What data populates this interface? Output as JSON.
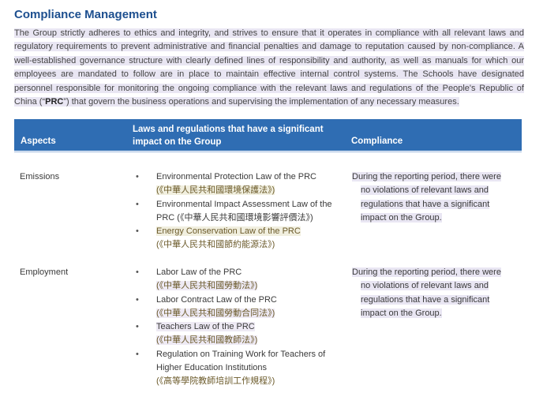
{
  "title": "Compliance Management",
  "intro": {
    "p1": "The Group strictly adheres to ethics and integrity, and strives to ensure that it operates in compliance with all relevant laws and regulatory requirements to prevent administrative and financial penalties and damage to reputation caused by non-compliance. A well-established governance structure with clearly defined lines of responsibility and authority, as well as manuals for which our employees are mandated to follow are in place to maintain effective internal control systems. The Schools have designated personnel responsible for monitoring the ongoing compliance with the relevant laws and regulations of the People's Republic of China (“",
    "bold": "PRC",
    "p2": "”) that govern the business operations and supervising the implementation of any necessary measures."
  },
  "table": {
    "headers": {
      "aspects": "Aspects",
      "laws": "Laws and regulations that have a significant impact on the Group",
      "compliance": "Compliance"
    },
    "rows": [
      {
        "aspect": "Emissions",
        "laws": [
          {
            "en": "Environmental Protection Law of the PRC",
            "cn": "(《中華人民共和國環境保護法》)"
          },
          {
            "en": "Environmental Impact Assessment Law of the PRC",
            "cn": "(《中華人民共和國環境影響評價法》)"
          },
          {
            "en": "Energy Conservation Law of the PRC",
            "cn": "(《中華人民共和國節約能源法》)"
          }
        ],
        "compliance": [
          "During the reporting period, there were",
          "no violations of relevant laws and",
          "regulations that have a significant",
          "impact on the Group."
        ]
      },
      {
        "aspect": "Employment",
        "laws": [
          {
            "en": "Labor Law of the PRC",
            "cn": "(《中華人民共和國勞動法》)"
          },
          {
            "en": "Labor Contract Law of the PRC",
            "cn": "(《中華人民共和國勞動合同法》)"
          },
          {
            "en": "Teachers Law of the PRC",
            "cn": "(《中華人民共和國教師法》)"
          },
          {
            "en": "Regulation on Training Work for Teachers of Higher Education Institutions",
            "cn": "(《高等學院教師培訓工作規程》)"
          }
        ],
        "compliance": [
          "During the reporting period, there were",
          "no violations of relevant laws and",
          "regulations that have a significant",
          "impact on the Group."
        ]
      }
    ]
  }
}
